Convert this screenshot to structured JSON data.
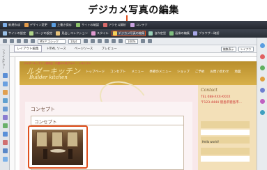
{
  "callout": {
    "text": "デジカメ写真の編集"
  },
  "toolbar1": {
    "items": [
      {
        "label": "新規作成",
        "icon": "new-icon",
        "color": "#7fb0e8"
      },
      {
        "label": "デザイン変更",
        "icon": "design-icon",
        "color": "#e39b4a"
      },
      {
        "label": "上書き保存",
        "icon": "save-icon",
        "color": "#5a9de0"
      },
      {
        "label": "サイトの確認",
        "icon": "preview-icon",
        "color": "#8bc06a"
      },
      {
        "label": "アクセス解析",
        "icon": "analytics-icon",
        "color": "#d86a6a"
      },
      {
        "label": "コンテナ",
        "icon": "container-icon",
        "color": "#c9a2e0"
      }
    ]
  },
  "toolbar2": {
    "items": [
      {
        "label": "サイトの設定",
        "icon": "settings-icon",
        "color": "#9ac0e6",
        "highlight": false
      },
      {
        "label": "ページの設定",
        "icon": "page-icon",
        "color": "#b0d48a",
        "highlight": false
      },
      {
        "label": "見出しコレクション",
        "icon": "heading-icon",
        "color": "#e6c27a",
        "highlight": false
      },
      {
        "label": "スタイル",
        "icon": "style-icon",
        "color": "#e09ad0",
        "highlight": false
      },
      {
        "label": "デジカメ写真の編集",
        "icon": "camera-icon",
        "color": "#f0d05a",
        "highlight": true
      },
      {
        "label": "自作定型",
        "icon": "template-icon",
        "color": "#9ad0b8",
        "highlight": false
      },
      {
        "label": "画像の編集",
        "icon": "image-edit-icon",
        "color": "#80c080",
        "highlight": false
      },
      {
        "label": "ブラウザー確認",
        "icon": "browser-icon",
        "color": "#a8a8e8",
        "highlight": false
      }
    ]
  },
  "toolbar3": {
    "font": "MS P ゴシック",
    "size": "10pt",
    "zoom": "100%"
  },
  "tabs": [
    {
      "label": "レイアウト編集",
      "active": true
    },
    {
      "label": "HTML ソース",
      "active": false
    },
    {
      "label": "ページソース",
      "active": false
    },
    {
      "label": "プレビュー",
      "active": false
    }
  ],
  "tab_controls": {
    "grid": "編集表示",
    "layout": "レイアウト"
  },
  "sidebar_left": {
    "label": "ファイルビュー"
  },
  "page": {
    "breadcrumb": "ジルダーキッチン | 精肉店 | 肉屋の人気グルメ ... レストラン",
    "logo": "ルダーキッチン",
    "logo_sub": "Builder kitchen",
    "nav": [
      "トップページ",
      "コンセプト",
      "メニュー",
      "季節のメニュー",
      "ショップ",
      "ご予約",
      "お問い合わせ",
      "地図"
    ],
    "concept_heading": "コンセプト",
    "concept_sub": "コンセプト",
    "contact": "Contact",
    "tel": "TEL 088-XXX-XXXX",
    "address": "〒123-4444 徳島県徳島市...",
    "hello": "Hello world!"
  }
}
